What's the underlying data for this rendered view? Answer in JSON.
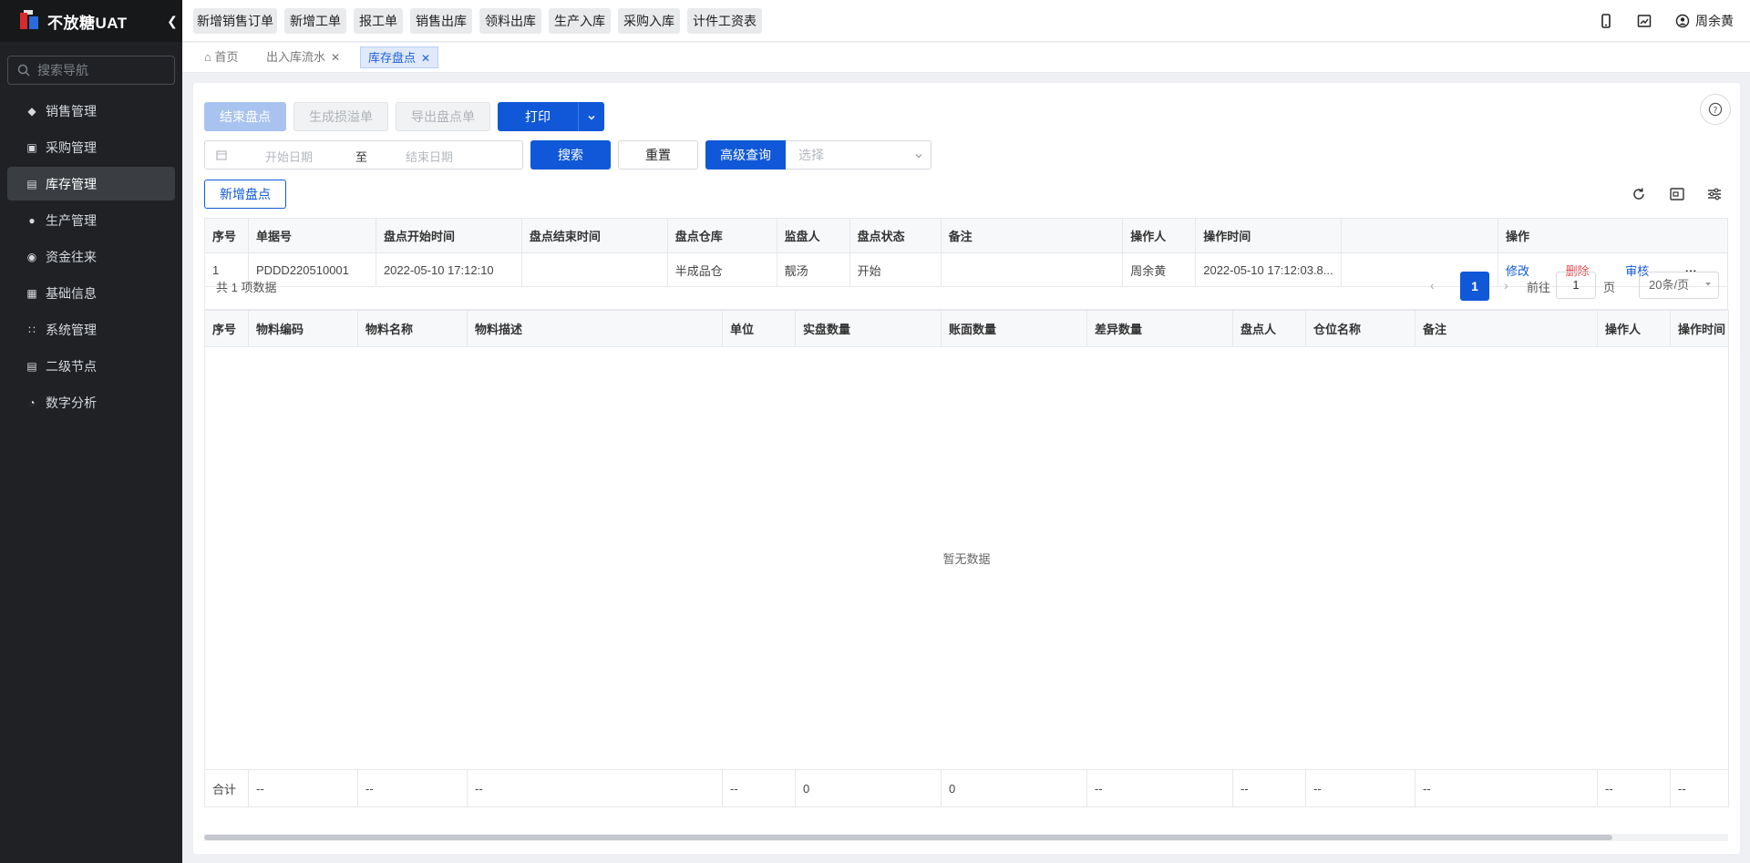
{
  "app": {
    "title": "不放糖UAT",
    "collapse_icon": "chevron-left-icon"
  },
  "sidebar": {
    "search_placeholder": "搜索导航",
    "items": [
      {
        "label": "销售管理",
        "icon": "tag-icon",
        "active": false
      },
      {
        "label": "采购管理",
        "icon": "cart-icon",
        "active": false
      },
      {
        "label": "库存管理",
        "icon": "inventory-icon",
        "active": true
      },
      {
        "label": "生产管理",
        "icon": "production-icon",
        "active": false
      },
      {
        "label": "资金往来",
        "icon": "coin-icon",
        "active": false
      },
      {
        "label": "基础信息",
        "icon": "grid-icon",
        "active": false
      },
      {
        "label": "系统管理",
        "icon": "dots-grid-icon",
        "active": false
      },
      {
        "label": "二级节点",
        "icon": "doc-icon",
        "active": false
      },
      {
        "label": "数字分析",
        "icon": "pie-icon",
        "active": false
      }
    ]
  },
  "quick_actions": [
    "新增销售订单",
    "新增工单",
    "报工单",
    "销售出库",
    "领料出库",
    "生产入库",
    "采购入库",
    "计件工资表"
  ],
  "user": {
    "name": "周余黄"
  },
  "tabs": [
    {
      "label": "首页",
      "closable": false,
      "active": false
    },
    {
      "label": "出入库流水",
      "closable": true,
      "active": false
    },
    {
      "label": "库存盘点",
      "closable": true,
      "active": true
    }
  ],
  "toolbar": {
    "end_check": "结束盘点",
    "gen_loss": "生成损溢单",
    "export": "导出盘点单",
    "print": "打印",
    "start_date_placeholder": "开始日期",
    "date_sep": "至",
    "end_date_placeholder": "结束日期",
    "search": "搜索",
    "reset": "重置",
    "advanced": "高级查询",
    "select_placeholder": "选择",
    "add": "新增盘点"
  },
  "main_table": {
    "headers": [
      "序号",
      "单据号",
      "盘点开始时间",
      "盘点结束时间",
      "盘点仓库",
      "监盘人",
      "盘点状态",
      "备注",
      "操作人",
      "操作时间",
      "",
      "操作"
    ],
    "rows": [
      {
        "idx": "1",
        "doc_no": "PDDD220510001",
        "start": "2022-05-10 17:12:10",
        "end": "",
        "warehouse": "半成品仓",
        "supervisor": "靓汤",
        "status": "开始",
        "remark": "",
        "operator": "周余黄",
        "op_time": "2022-05-10 17:12:03.8...",
        "extra": "",
        "actions": {
          "edit": "修改",
          "delete": "删除",
          "audit": "审核",
          "more": "···"
        }
      }
    ]
  },
  "pagination": {
    "total_text": "共 1 项数据",
    "current": "1",
    "goto_label": "前往",
    "goto_value": "1",
    "page_unit": "页",
    "page_size": "20条/页"
  },
  "detail_table": {
    "headers": [
      "序号",
      "物料编码",
      "物料名称",
      "物料描述",
      "单位",
      "实盘数量",
      "账面数量",
      "差异数量",
      "盘点人",
      "仓位名称",
      "备注",
      "操作人",
      "操作时间"
    ],
    "empty_text": "暂无数据",
    "summary": [
      "合计",
      "--",
      "--",
      "--",
      "--",
      "0",
      "0",
      "--",
      "--",
      "--",
      "--",
      "--",
      "--"
    ]
  },
  "colors": {
    "primary": "#1058d8",
    "sidebar_bg": "#1f2124",
    "danger": "#e5484d"
  }
}
